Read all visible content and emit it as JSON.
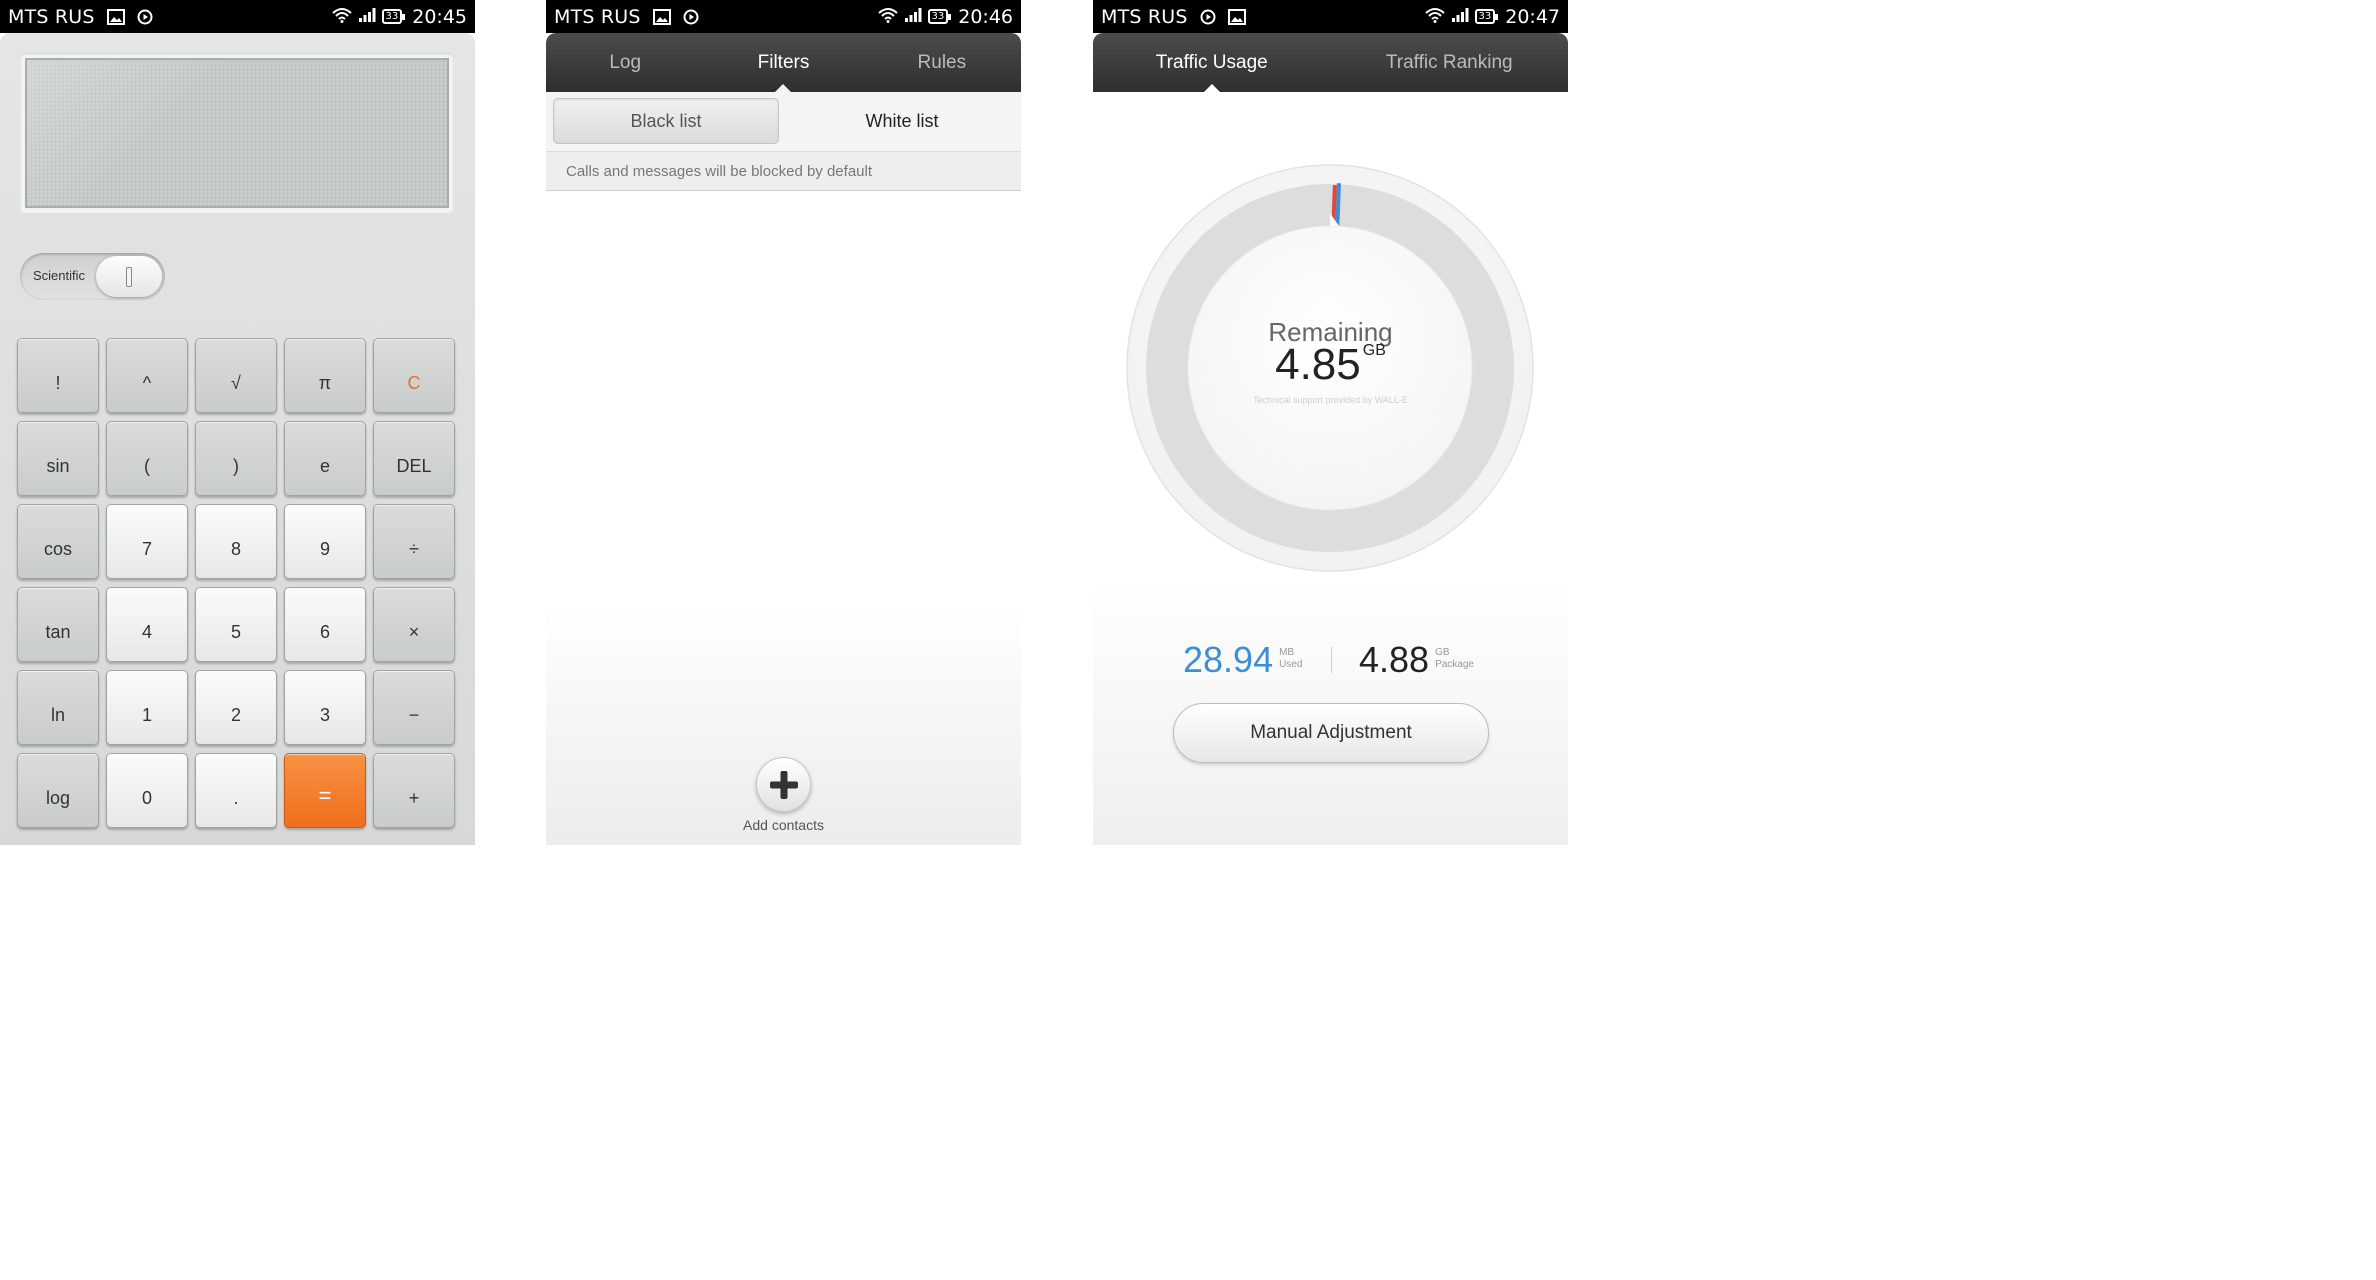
{
  "colors": {
    "accent_orange": "#ef6f1e",
    "used_blue": "#3a8fd6",
    "tabbar_dark": "#2c2e30"
  },
  "screens": [
    {
      "status": {
        "carrier": "MTS RUS",
        "time": "20:45",
        "battery": "33"
      },
      "calculator": {
        "toggle_label": "Scientific",
        "keys": [
          {
            "label": "!",
            "style": "fn"
          },
          {
            "label": "^",
            "style": "fn"
          },
          {
            "label": "√",
            "style": "fn"
          },
          {
            "label": "π",
            "style": "fn"
          },
          {
            "label": "C",
            "style": "fn orange-text"
          },
          {
            "label": "sin",
            "style": "fn"
          },
          {
            "label": "(",
            "style": "fn"
          },
          {
            "label": ")",
            "style": "fn"
          },
          {
            "label": "e",
            "style": "fn"
          },
          {
            "label": "DEL",
            "style": "fn"
          },
          {
            "label": "cos",
            "style": "fn"
          },
          {
            "label": "7",
            "style": "num"
          },
          {
            "label": "8",
            "style": "num"
          },
          {
            "label": "9",
            "style": "num"
          },
          {
            "label": "÷",
            "style": "fn"
          },
          {
            "label": "tan",
            "style": "fn"
          },
          {
            "label": "4",
            "style": "num"
          },
          {
            "label": "5",
            "style": "num"
          },
          {
            "label": "6",
            "style": "num"
          },
          {
            "label": "×",
            "style": "fn"
          },
          {
            "label": "ln",
            "style": "fn"
          },
          {
            "label": "1",
            "style": "num"
          },
          {
            "label": "2",
            "style": "num"
          },
          {
            "label": "3",
            "style": "num"
          },
          {
            "label": "−",
            "style": "fn"
          },
          {
            "label": "log",
            "style": "fn"
          },
          {
            "label": "0",
            "style": "num"
          },
          {
            "label": ".",
            "style": "num"
          },
          {
            "label": "=",
            "style": "equals"
          },
          {
            "label": "+",
            "style": "fn"
          }
        ]
      }
    },
    {
      "status": {
        "carrier": "MTS RUS",
        "time": "20:46",
        "battery": "33"
      },
      "tabs": [
        "Log",
        "Filters",
        "Rules"
      ],
      "active_tab": "Filters",
      "segments": {
        "left": "Black list",
        "right": "White list"
      },
      "info": "Calls and messages will be blocked by default",
      "add_label": "Add contacts"
    },
    {
      "status": {
        "carrier": "MTS RUS",
        "time": "20:47",
        "battery": "33"
      },
      "tabs": [
        "Traffic Usage",
        "Traffic Ranking"
      ],
      "active_tab": "Traffic Usage",
      "gauge": {
        "label": "Remaining",
        "value": "4.85",
        "unit": "GB",
        "support": "Technical support provided by WALL-E",
        "used_fraction": 0.006
      },
      "used": {
        "value": "28.94",
        "unit": "MB",
        "label": "Used"
      },
      "package": {
        "value": "4.88",
        "unit": "GB",
        "label": "Package"
      },
      "manual_button": "Manual Adjustment"
    }
  ]
}
